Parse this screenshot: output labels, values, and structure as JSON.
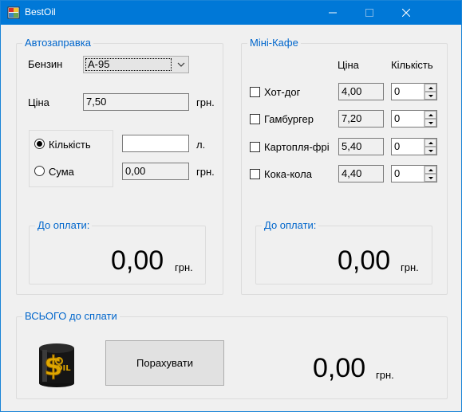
{
  "window": {
    "title": "BestOil"
  },
  "fuel": {
    "legend": "Автозаправка",
    "fuel_label": "Бензин",
    "fuel_selected": "А-95",
    "price_label": "Ціна",
    "price_value": "7,50",
    "price_unit": "грн.",
    "qty_option_label": "Кількість",
    "qty_value": "",
    "qty_unit": "л.",
    "sum_option_label": "Сума",
    "sum_value": "0,00",
    "sum_unit": "грн.",
    "selected_mode": "Кількість",
    "total_legend": "До оплати:",
    "total_value": "0,00",
    "total_unit": "грн."
  },
  "cafe": {
    "legend": "Міні-Кафе",
    "col_price": "Ціна",
    "col_qty": "Кількість",
    "items": [
      {
        "label": "Хот-дог",
        "price": "4,00",
        "qty": "0",
        "checked": false
      },
      {
        "label": "Гамбургер",
        "price": "7,20",
        "qty": "0",
        "checked": false
      },
      {
        "label": "Картопля-фрі",
        "price": "5,40",
        "qty": "0",
        "checked": false
      },
      {
        "label": "Кока-кола",
        "price": "4,40",
        "qty": "0",
        "checked": false
      }
    ],
    "total_legend": "До оплати:",
    "total_value": "0,00",
    "total_unit": "грн."
  },
  "grand": {
    "legend": "ВСЬОГО до сплати",
    "logo_icon": "oil-barrel-dollar-icon",
    "calc_button": "Порахувати",
    "total_value": "0,00",
    "total_unit": "грн."
  },
  "colors": {
    "titlebar": "#0078d7",
    "legend_text": "#0066cc",
    "window_bg": "#f0f0f0"
  }
}
